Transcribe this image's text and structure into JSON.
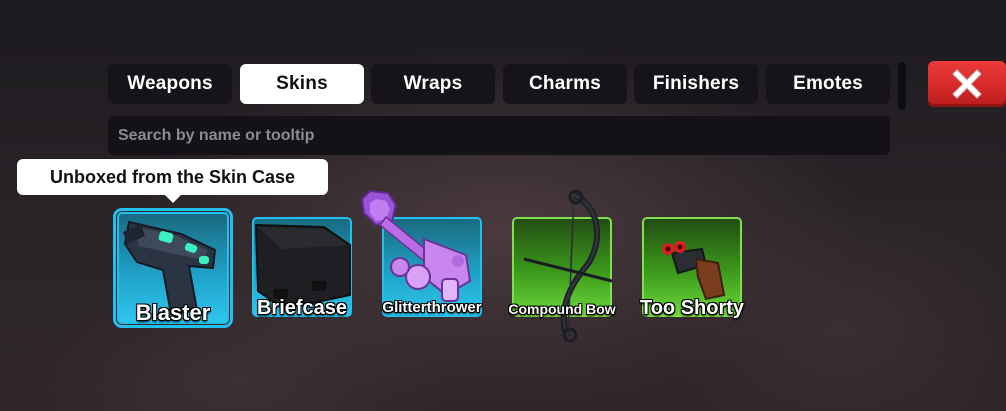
{
  "tabs": [
    {
      "label": "Weapons",
      "active": false
    },
    {
      "label": "Skins",
      "active": true
    },
    {
      "label": "Wraps",
      "active": false
    },
    {
      "label": "Charms",
      "active": false
    },
    {
      "label": "Finishers",
      "active": false
    },
    {
      "label": "Emotes",
      "active": false
    }
  ],
  "close_icon": "close-x-icon",
  "search": {
    "placeholder": "Search by name or tooltip",
    "value": ""
  },
  "tooltip": {
    "text": "Unboxed from the Skin Case"
  },
  "items": [
    {
      "label": "Blaster",
      "rarity_color": "#22c0f0",
      "icon": "blaster-icon",
      "selected": true
    },
    {
      "label": "Briefcase",
      "rarity_color": "#22c0f0",
      "icon": "briefcase-icon",
      "selected": false
    },
    {
      "label": "Glitterthrower",
      "rarity_color": "#22c0f0",
      "icon": "glitterthrower-icon",
      "selected": false
    },
    {
      "label": "Compound Bow",
      "rarity_color": "#7ee04a",
      "icon": "compound-bow-icon",
      "selected": false
    },
    {
      "label": "Too Shorty",
      "rarity_color": "#7ee04a",
      "icon": "too-shorty-icon",
      "selected": false
    }
  ],
  "colors": {
    "accent_blue": "#22c0f0",
    "accent_green": "#7ee04a",
    "close_red": "#d42828"
  }
}
